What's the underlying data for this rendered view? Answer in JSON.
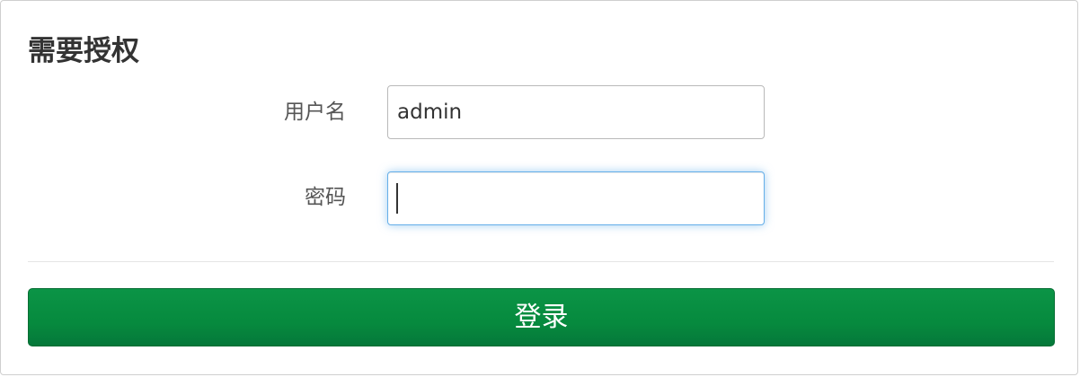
{
  "dialog": {
    "title": "需要授权",
    "username": {
      "label": "用户名",
      "value": "admin"
    },
    "password": {
      "label": "密码",
      "value": ""
    },
    "login_button": "登录"
  },
  "colors": {
    "button_green": "#068a3e",
    "focus_blue": "#66afe9"
  }
}
